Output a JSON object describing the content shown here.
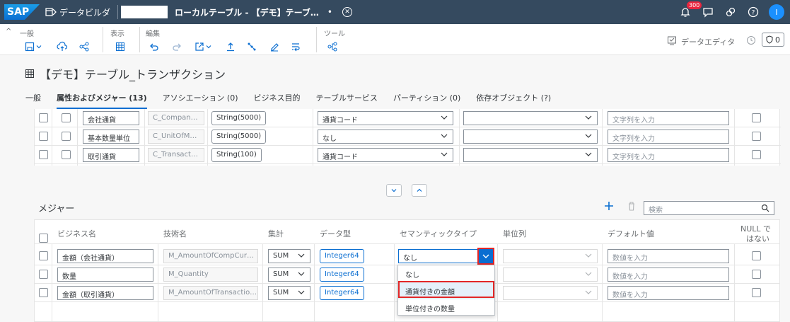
{
  "shell": {
    "logo": "SAP",
    "app_title": "データビルダ",
    "object_title": "ローカルテーブル - 【デモ】テーブ…",
    "unsaved_dot": "•",
    "notification_count": "300",
    "avatar_initial": "I"
  },
  "toolbar": {
    "groups": {
      "general": "一般",
      "view": "表示",
      "edit": "編集",
      "tools": "ツール"
    },
    "data_editor": "データエディタ",
    "status_count": "0"
  },
  "page": {
    "title": "【デモ】テーブル_トランザクション",
    "tabs": [
      "一般",
      "属性およびメジャー (13)",
      "アソシエーション (0)",
      "ビジネス目的",
      "テーブルサービス",
      "パーティション (0)",
      "依存オブジェクト (?)"
    ]
  },
  "attributes": {
    "rows": [
      {
        "business_name": "会社通貨",
        "technical_name": "C_Compan…",
        "data_type": "String(5000)",
        "semantic": "通貨コード",
        "placeholder": "文字列を入力"
      },
      {
        "business_name": "基本数量単位",
        "technical_name": "C_UnitOfM…",
        "data_type": "String(5000)",
        "semantic": "なし",
        "placeholder": "文字列を入力"
      },
      {
        "business_name": "取引通貨",
        "technical_name": "C_Transact…",
        "data_type": "String(100)",
        "semantic": "通貨コード",
        "placeholder": "文字列を入力"
      }
    ]
  },
  "measures": {
    "title": "メジャー",
    "search_placeholder": "検索",
    "columns": {
      "business_name": "ビジネス名",
      "technical_name": "技術名",
      "aggregation": "集計",
      "data_type": "データ型",
      "semantic": "セマンティックタイプ",
      "unit_column": "単位列",
      "default_value": "デフォルト値",
      "not_null_1": "NULL で",
      "not_null_2": "はない"
    },
    "rows": [
      {
        "business_name": "金額（会社通貨）",
        "technical_name": "M_AmountOfCompCur…",
        "aggregation": "SUM",
        "data_type": "Integer64",
        "semantic": "なし",
        "default_placeholder": "数値を入力"
      },
      {
        "business_name": "数量",
        "technical_name": "M_Quantity",
        "aggregation": "SUM",
        "data_type": "Integer64",
        "semantic": "",
        "default_placeholder": "数値を入力"
      },
      {
        "business_name": "金額（取引通貨）",
        "technical_name": "M_AmountOfTransactio…",
        "aggregation": "SUM",
        "data_type": "Integer64",
        "semantic": "",
        "default_placeholder": "数値を入力"
      }
    ],
    "dropdown_options": [
      "なし",
      "通貨付きの金額",
      "単位付きの数量"
    ]
  },
  "colors": {
    "shell": "#354a5f",
    "accent": "#0a6ed1",
    "highlight_border": "#e32727",
    "badge": "#e9263f"
  }
}
